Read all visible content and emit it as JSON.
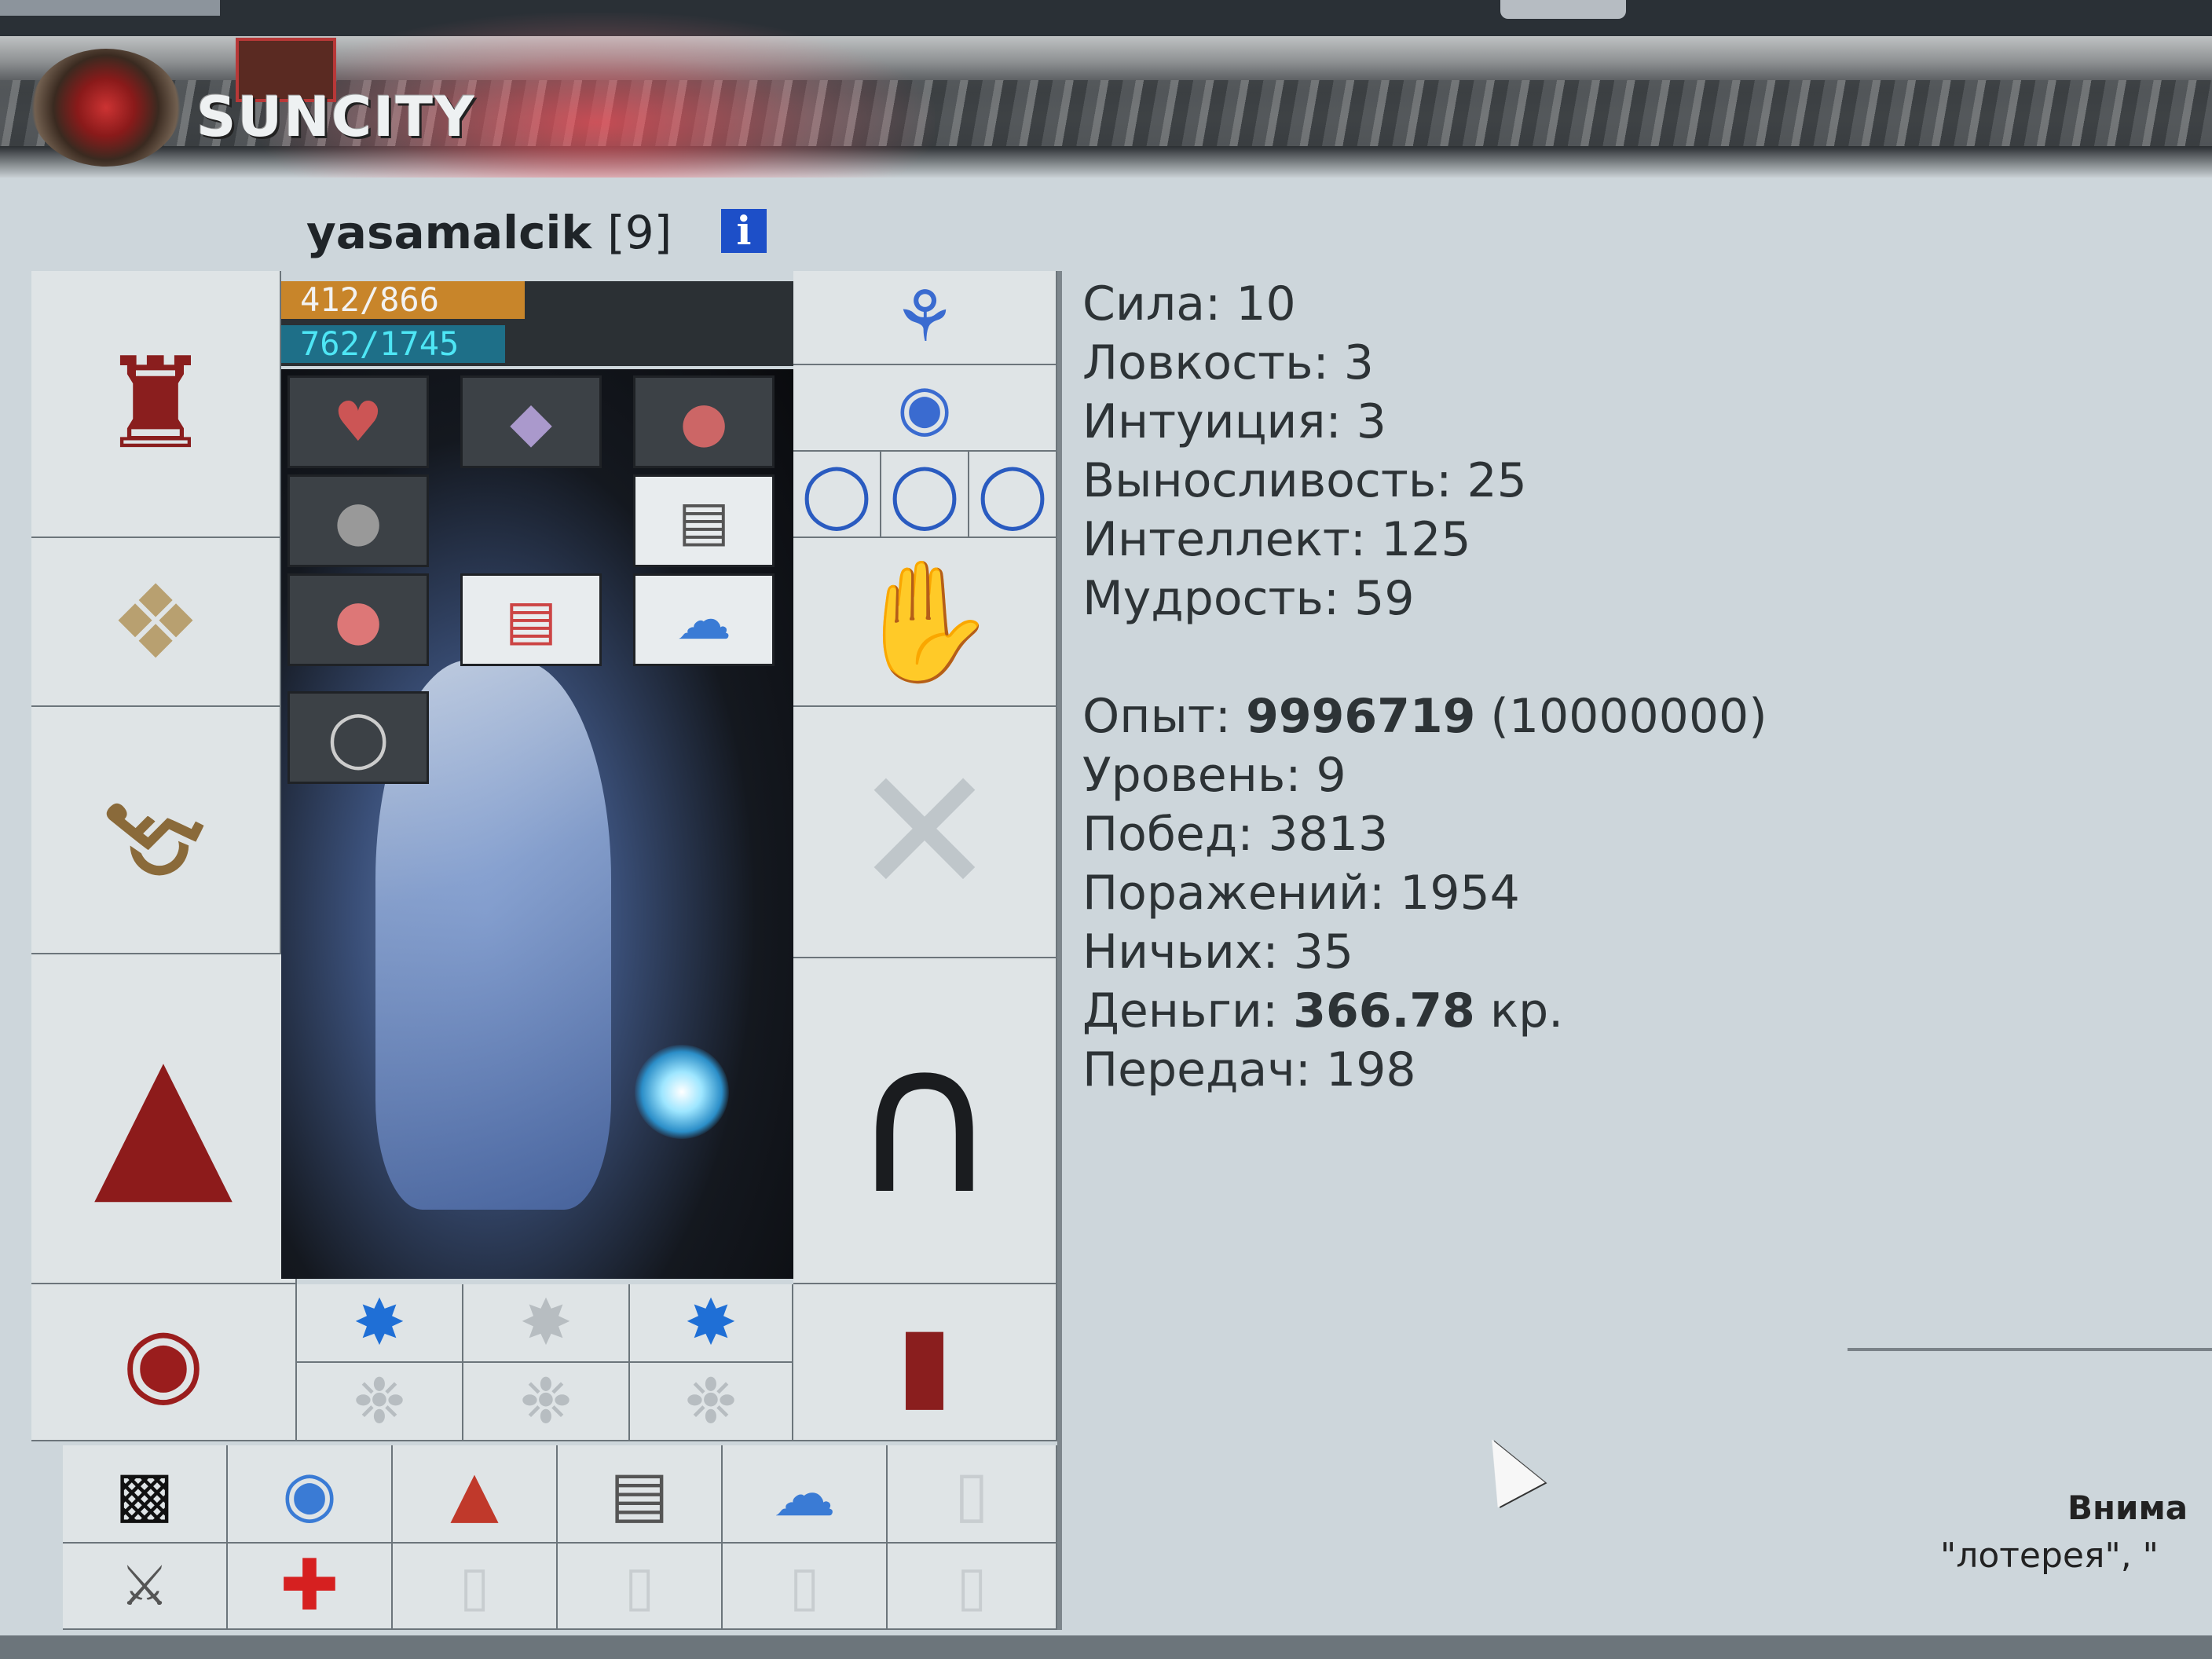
{
  "header": {
    "logo": "SUNCITY"
  },
  "character": {
    "name": "yasamalcik",
    "level_tag": "[9]",
    "info_icon": "i"
  },
  "bars": {
    "hp": {
      "text": "412/866",
      "fraction": 0.476,
      "color": "#c8852a"
    },
    "mp": {
      "text": "762/1745",
      "fraction": 0.437,
      "color": "#1e6f88"
    }
  },
  "equipment": {
    "left": [
      "helmet-icon",
      "bracers-icon",
      "staff-icon",
      "robe-icon",
      "belt-icon"
    ],
    "right": [
      "earrings-icon",
      "amulet-icon",
      "rings-icon",
      "gloves-icon",
      "empty-weapon-slot-icon",
      "pants-icon",
      "boots-icon"
    ],
    "bottom_row1": [
      "blue-rune-icon",
      "empty-rune-icon",
      "blue-rune-icon"
    ],
    "bottom_row2": [
      "empty-rune-icon",
      "empty-rune-icon",
      "empty-rune-icon"
    ],
    "inventory": [
      "sunglasses-scroll-icon",
      "orb-scroll-icon",
      "potion-scroll-icon",
      "bag-scroll-icon",
      "cloud-scroll-icon",
      "blank-scroll-icon",
      "sword-scroll-icon",
      "heal-scroll-icon",
      "blank-scroll-icon",
      "blank-scroll-icon",
      "blank-scroll-icon",
      "blank-scroll-icon"
    ]
  },
  "stats": [
    {
      "label": "Сила:",
      "value": "10"
    },
    {
      "label": "Ловкость:",
      "value": "3"
    },
    {
      "label": "Интуиция:",
      "value": "3"
    },
    {
      "label": "Выносливость:",
      "value": "25"
    },
    {
      "label": "Интеллект:",
      "value": "125"
    },
    {
      "label": "Мудрость:",
      "value": "59"
    }
  ],
  "progress": {
    "exp_label": "Опыт:",
    "exp_value": "9996719",
    "exp_next": "(10000000)",
    "level_label": "Уровень:",
    "level_value": "9",
    "wins_label": "Побед:",
    "wins_value": "3813",
    "losses_label": "Поражений:",
    "losses_value": "1954",
    "draws_label": "Ничьих:",
    "draws_value": "35",
    "money_label": "Деньги:",
    "money_value": "366.78",
    "money_unit": "кр.",
    "transfers_label": "Передач:",
    "transfers_value": "198"
  },
  "notice": {
    "attention": "Внима",
    "lottery": "\"лотерея\", \""
  }
}
